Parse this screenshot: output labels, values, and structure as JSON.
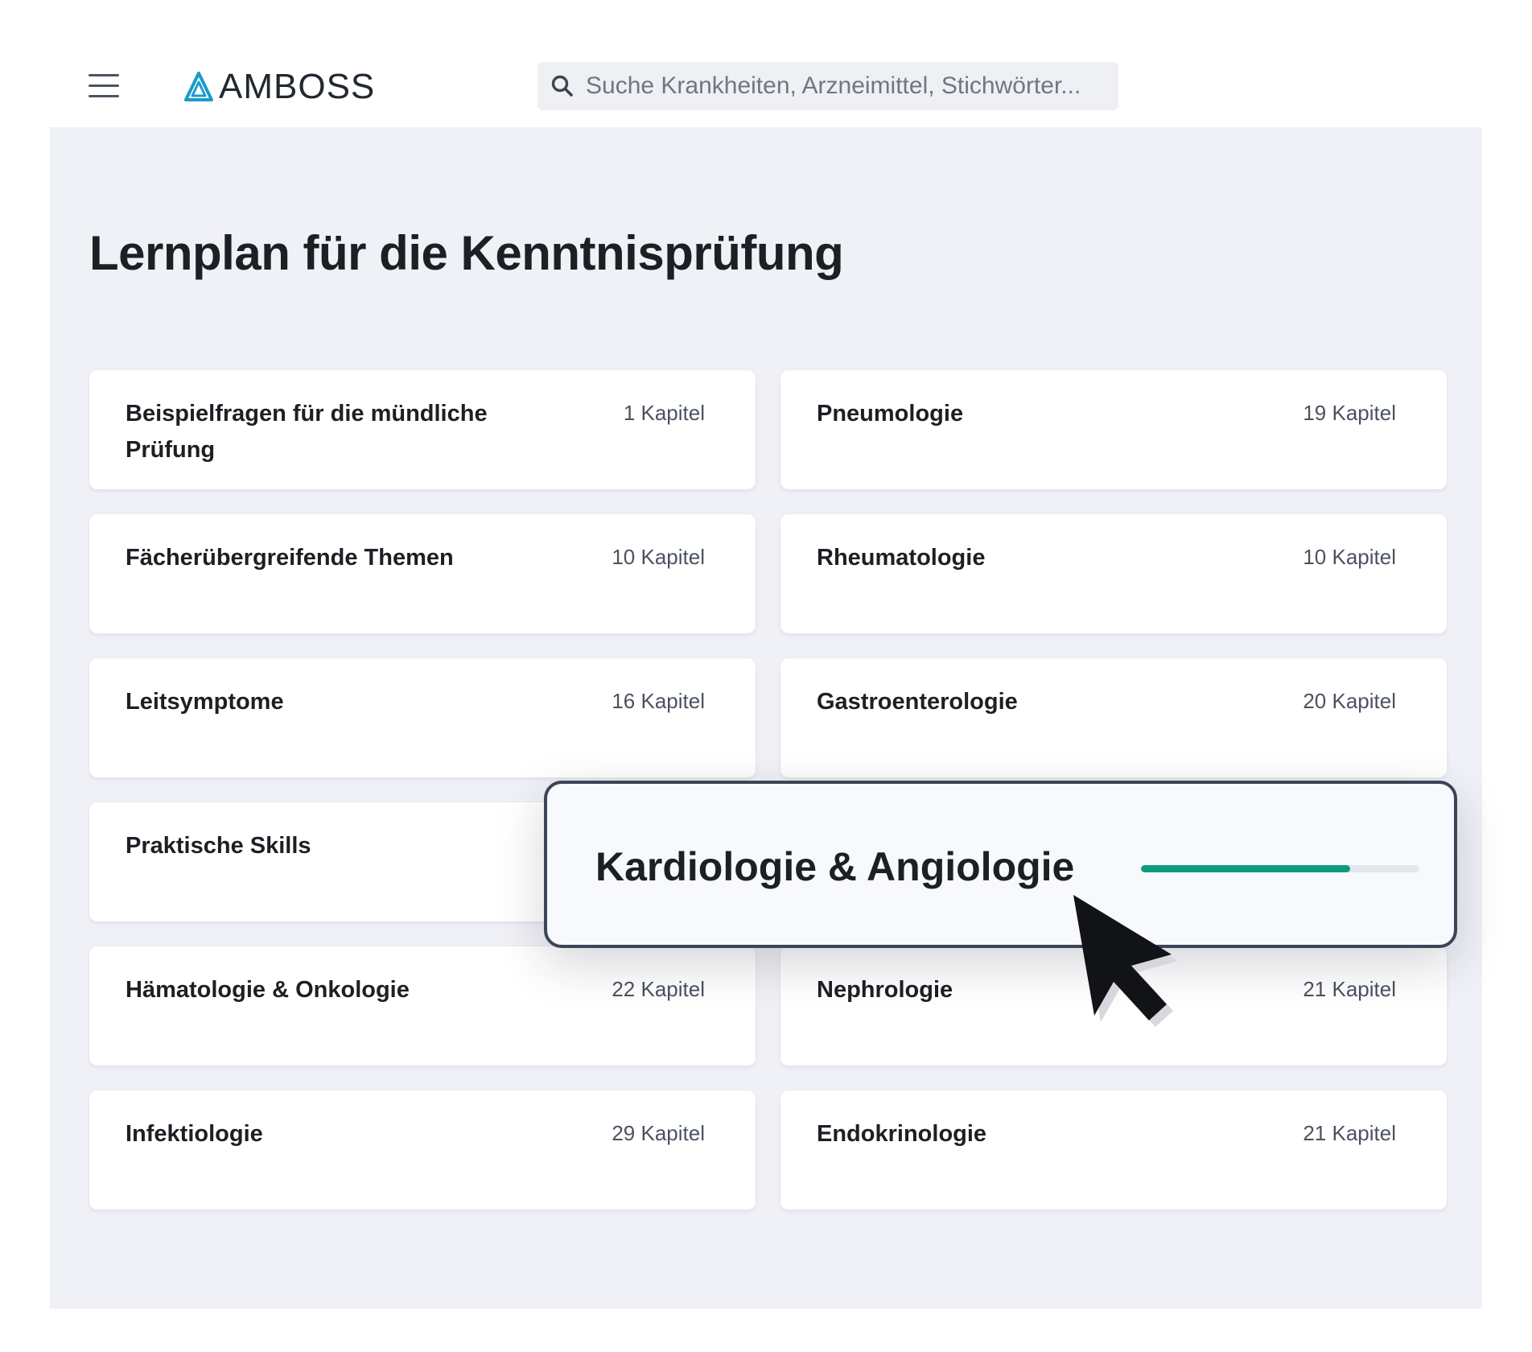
{
  "header": {
    "brand": "AMBOSS",
    "search_placeholder": "Suche Krankheiten, Arzneimittel, Stichwörter..."
  },
  "page": {
    "title": "Lernplan für die Kenntnisprüfung"
  },
  "topics": [
    {
      "title": "Beispielfragen für die mündliche Prüfung",
      "count": "1 Kapitel"
    },
    {
      "title": "Pneumologie",
      "count": "19 Kapitel"
    },
    {
      "title": "Fächerübergreifende Themen",
      "count": "10 Kapitel"
    },
    {
      "title": "Rheumatologie",
      "count": "10 Kapitel"
    },
    {
      "title": "Leitsymptome",
      "count": "16 Kapitel"
    },
    {
      "title": "Gastroenterologie",
      "count": "20 Kapitel"
    },
    {
      "title": "Praktische Skills",
      "count": ""
    },
    {
      "title": "Hämatologie & Onkologie",
      "count": "22 Kapitel"
    },
    {
      "title": "Nephrologie",
      "count": "21 Kapitel"
    },
    {
      "title": "Infektiologie",
      "count": "29 Kapitel"
    },
    {
      "title": "Endokrinologie",
      "count": "21 Kapitel"
    }
  ],
  "highlight": {
    "title": "Kardiologie & Angiologie",
    "progress": 0.75
  },
  "colors": {
    "accent": "#0f9a80",
    "logo": "#1a9bc9",
    "background": "#f0f1f6"
  },
  "icons": {
    "menu": "hamburger-icon",
    "logo": "amboss-triangle-logo",
    "search": "search-icon",
    "pointer": "mouse-cursor"
  }
}
